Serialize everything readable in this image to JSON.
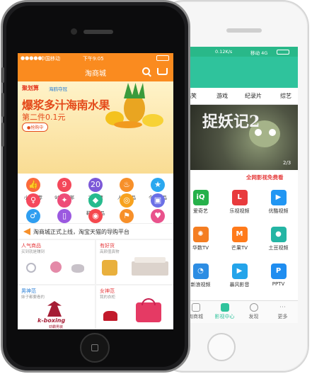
{
  "front": {
    "status": {
      "carrier": "中国移动",
      "time": "下午9:05"
    },
    "navbar": {
      "title": "淘商城"
    },
    "banner": {
      "brand_left": "聚划算",
      "brand_right": "海鸥夺冠",
      "headline": "爆浆多汁海南水果",
      "subline": "第二件0.1元",
      "button": "●抢购中"
    },
    "grid": [
      {
        "label": "小编推荐",
        "icon": "thumbs-up-icon",
        "color": "#fb6a3b",
        "glyph": "👍"
      },
      {
        "label": "9块9包邮",
        "icon": "truck-icon",
        "color": "#f4475a",
        "glyph": "9"
      },
      {
        "label": "20封顶",
        "icon": "price-tag-icon",
        "color": "#7c59d8",
        "glyph": "20"
      },
      {
        "label": "人气商品",
        "icon": "flame-icon",
        "color": "#f7902a",
        "glyph": "♨"
      },
      {
        "label": "今日新品",
        "icon": "new-badge-icon",
        "color": "#2ba8ef",
        "glyph": "★"
      },
      {
        "label": "女装",
        "icon": "dress-icon",
        "color": "#f5495d",
        "glyph": "♀"
      },
      {
        "label": "美妆",
        "icon": "lipstick-icon",
        "color": "#ee4c78",
        "glyph": "✦"
      },
      {
        "label": "鞋包饰品",
        "icon": "handbag-icon",
        "color": "#27bb8e",
        "glyph": "◆"
      },
      {
        "label": "母婴",
        "icon": "baby-bottle-icon",
        "color": "#f7a21f",
        "glyph": "◎"
      },
      {
        "label": "家居",
        "icon": "sofa-icon",
        "color": "#6b70e6",
        "glyph": "▣"
      },
      {
        "label": "男装",
        "icon": "shirt-icon",
        "color": "#2f9ef0",
        "glyph": "♂"
      },
      {
        "label": "手机数码",
        "icon": "phone-icon",
        "color": "#9b59e0",
        "glyph": "▯"
      },
      {
        "label": "食品",
        "icon": "food-icon",
        "color": "#f5484e",
        "glyph": "◉"
      },
      {
        "label": "运动户外",
        "icon": "sport-icon",
        "color": "#f7902a",
        "glyph": "⚑"
      },
      {
        "label": "内衣配饰",
        "icon": "underwear-icon",
        "color": "#e9528c",
        "glyph": "♥"
      }
    ],
    "notice": {
      "text": "淘商城正式上线，淘宝天猫的导购平台"
    },
    "cards": [
      {
        "title": "人气商品",
        "sub": "买到就是赚到",
        "title_color": "#e5383b"
      },
      {
        "title": "有好货",
        "sub": "高颜值真物",
        "title_color": "#e5383b"
      },
      {
        "title": "男神范",
        "sub": "妹子都要看的",
        "title_color": "#2a7fd6"
      },
      {
        "title": "女神范",
        "sub": "我的衣柜",
        "title_color": "#e5383b"
      }
    ],
    "card_brand": {
      "name": "k-boxing",
      "sub": "劲霸男装"
    }
  },
  "back": {
    "status": {
      "speed": "0.12K/s",
      "carrier": "移动 4G"
    },
    "tabs": [
      "搞笑",
      "游戏",
      "纪录片",
      "综艺"
    ],
    "poster": {
      "title": "捉妖记2",
      "pager": "2/3"
    },
    "free_text": "全网影视免费看",
    "apps": [
      {
        "label": "爱奇艺",
        "icon": "iqiyi-icon",
        "color": "#26b14a",
        "glyph": "iQ"
      },
      {
        "label": "乐视视频",
        "icon": "letv-icon",
        "color": "#e83a3d",
        "glyph": "L"
      },
      {
        "label": "优酷视频",
        "icon": "youku-icon",
        "color": "#2196f3",
        "glyph": "▶"
      },
      {
        "label": "华数TV",
        "icon": "wasu-icon",
        "color": "#f47d21",
        "glyph": "✺"
      },
      {
        "label": "芒果TV",
        "icon": "mango-icon",
        "color": "#ff7a1a",
        "glyph": "M"
      },
      {
        "label": "土豆视频",
        "icon": "tudou-icon",
        "color": "#24b5a4",
        "glyph": "●"
      },
      {
        "label": "新浪视频",
        "icon": "sina-icon",
        "color": "#2d8de3",
        "glyph": "◔"
      },
      {
        "label": "暴风影音",
        "icon": "baofeng-icon",
        "color": "#24a4ea",
        "glyph": "▶"
      },
      {
        "label": "PPTV",
        "icon": "pptv-icon",
        "color": "#1f8df0",
        "glyph": "P"
      }
    ],
    "bottom_tabs": [
      "淘商城",
      "影视中心",
      "发现",
      "更多"
    ]
  }
}
